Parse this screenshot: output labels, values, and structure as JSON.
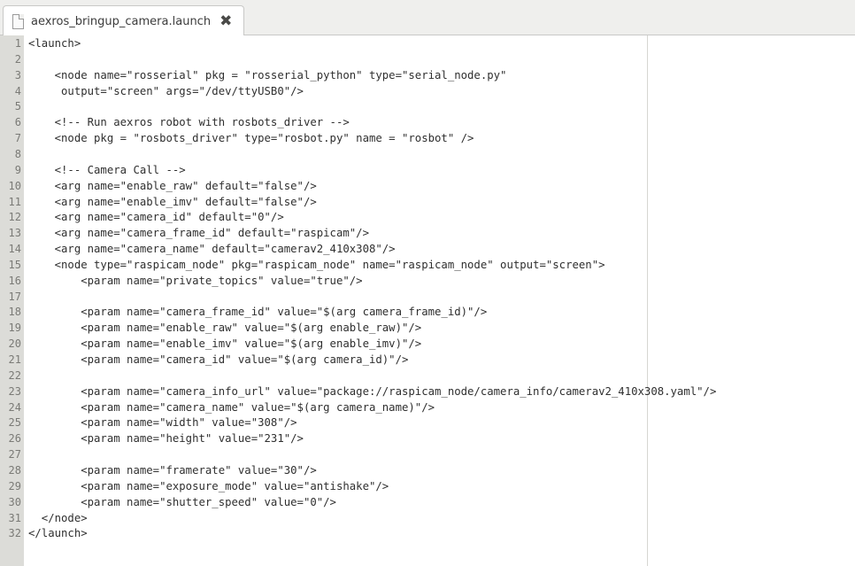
{
  "tab": {
    "title": "aexros_bringup_camera.launch",
    "close_icon": "close-icon"
  },
  "editor": {
    "lines": [
      {
        "n": "1",
        "text": "<launch>"
      },
      {
        "n": "2",
        "text": ""
      },
      {
        "n": "3",
        "text": "    <node name=\"rosserial\" pkg = \"rosserial_python\" type=\"serial_node.py\""
      },
      {
        "n": "4",
        "text": "     output=\"screen\" args=\"/dev/ttyUSB0\"/>"
      },
      {
        "n": "5",
        "text": ""
      },
      {
        "n": "6",
        "text": "    <!-- Run aexros robot with rosbots_driver -->"
      },
      {
        "n": "7",
        "text": "    <node pkg = \"rosbots_driver\" type=\"rosbot.py\" name = \"rosbot\" />"
      },
      {
        "n": "8",
        "text": ""
      },
      {
        "n": "9",
        "text": "    <!-- Camera Call -->"
      },
      {
        "n": "10",
        "text": "    <arg name=\"enable_raw\" default=\"false\"/>"
      },
      {
        "n": "11",
        "text": "    <arg name=\"enable_imv\" default=\"false\"/>"
      },
      {
        "n": "12",
        "text": "    <arg name=\"camera_id\" default=\"0\"/>"
      },
      {
        "n": "13",
        "text": "    <arg name=\"camera_frame_id\" default=\"raspicam\"/>"
      },
      {
        "n": "14",
        "text": "    <arg name=\"camera_name\" default=\"camerav2_410x308\"/>"
      },
      {
        "n": "15",
        "text": "    <node type=\"raspicam_node\" pkg=\"raspicam_node\" name=\"raspicam_node\" output=\"screen\">"
      },
      {
        "n": "16",
        "text": "        <param name=\"private_topics\" value=\"true\"/>"
      },
      {
        "n": "17",
        "text": ""
      },
      {
        "n": "18",
        "text": "        <param name=\"camera_frame_id\" value=\"$(arg camera_frame_id)\"/>"
      },
      {
        "n": "19",
        "text": "        <param name=\"enable_raw\" value=\"$(arg enable_raw)\"/>"
      },
      {
        "n": "20",
        "text": "        <param name=\"enable_imv\" value=\"$(arg enable_imv)\"/>"
      },
      {
        "n": "21",
        "text": "        <param name=\"camera_id\" value=\"$(arg camera_id)\"/>"
      },
      {
        "n": "22",
        "text": ""
      },
      {
        "n": "23",
        "text": "        <param name=\"camera_info_url\" value=\"package://raspicam_node/camera_info/camerav2_410x308.yaml\"/>"
      },
      {
        "n": "24",
        "text": "        <param name=\"camera_name\" value=\"$(arg camera_name)\"/>"
      },
      {
        "n": "25",
        "text": "        <param name=\"width\" value=\"308\"/>"
      },
      {
        "n": "26",
        "text": "        <param name=\"height\" value=\"231\"/>"
      },
      {
        "n": "27",
        "text": ""
      },
      {
        "n": "28",
        "text": "        <param name=\"framerate\" value=\"30\"/>"
      },
      {
        "n": "29",
        "text": "        <param name=\"exposure_mode\" value=\"antishake\"/>"
      },
      {
        "n": "30",
        "text": "        <param name=\"shutter_speed\" value=\"0\"/>"
      },
      {
        "n": "31",
        "text": "  </node>"
      },
      {
        "n": "32",
        "text": "</launch>"
      }
    ]
  }
}
